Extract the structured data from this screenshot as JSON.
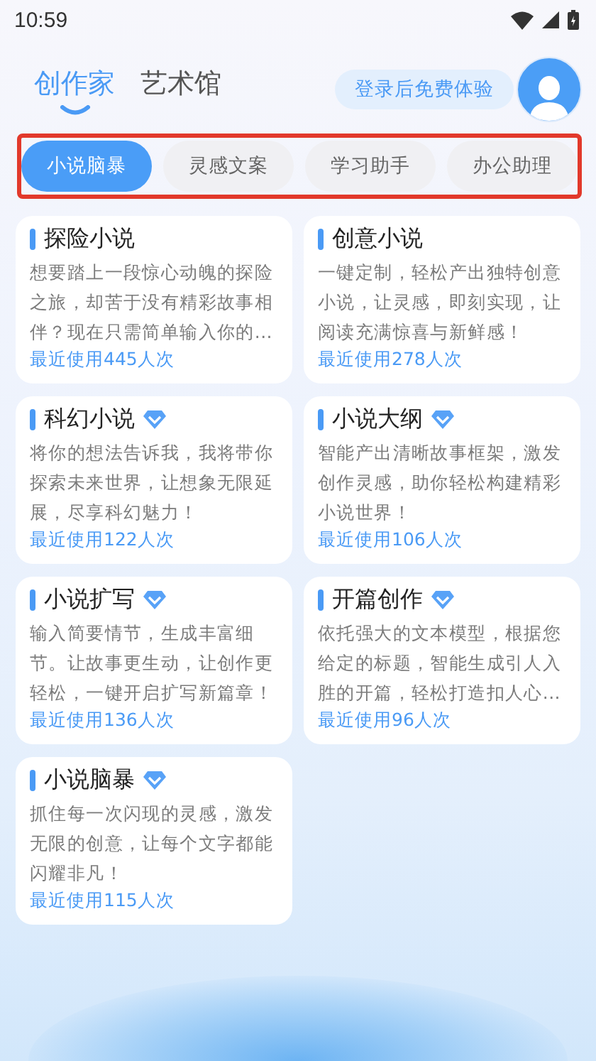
{
  "status_bar": {
    "time": "10:59"
  },
  "header": {
    "tabs": [
      {
        "label": "创作家",
        "selected": true
      },
      {
        "label": "艺术馆",
        "selected": false
      }
    ],
    "login_button": "登录后免费体验"
  },
  "categories": [
    {
      "label": "小说脑暴",
      "selected": true
    },
    {
      "label": "灵感文案",
      "selected": false
    },
    {
      "label": "学习助手",
      "selected": false
    },
    {
      "label": "办公助理",
      "selected": false
    }
  ],
  "cards": [
    {
      "title": "探险小说",
      "premium": false,
      "description": "想要踏上一段惊心动魄的探险之旅，却苦于没有精彩故事相伴？现在只需简单输入你的...",
      "usage": "最近使用445人次"
    },
    {
      "title": "创意小说",
      "premium": false,
      "description": "一键定制，轻松产出独特创意小说，让灵感，即刻实现，让阅读充满惊喜与新鲜感！",
      "usage": "最近使用278人次"
    },
    {
      "title": "科幻小说",
      "premium": true,
      "description": "将你的想法告诉我，我将带你探索未来世界，让想象无限延展，尽享科幻魅力！",
      "usage": "最近使用122人次"
    },
    {
      "title": "小说大纲",
      "premium": true,
      "description": "智能产出清晰故事框架，激发创作灵感，助你轻松构建精彩小说世界！",
      "usage": "最近使用106人次"
    },
    {
      "title": "小说扩写",
      "premium": true,
      "description": "输入简要情节，生成丰富细节。让故事更生动，让创作更轻松，一键开启扩写新篇章！",
      "usage": "最近使用136人次"
    },
    {
      "title": "开篇创作",
      "premium": true,
      "description": "依托强大的文本模型，根据您给定的标题，智能生成引人入胜的开篇，轻松打造扣人心...",
      "usage": "最近使用96人次"
    },
    {
      "title": "小说脑暴",
      "premium": true,
      "description": "抓住每一次闪现的灵感，激发无限的创意，让每个文字都能闪耀非凡！",
      "usage": "最近使用115人次"
    }
  ]
}
